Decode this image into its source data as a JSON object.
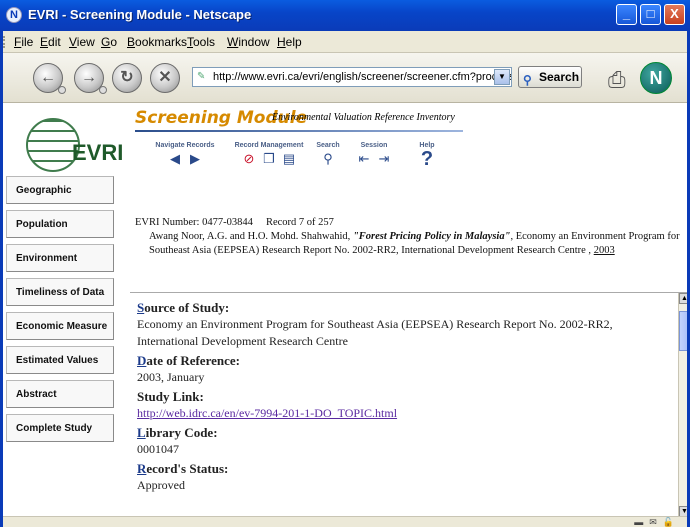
{
  "window": {
    "title": "EVRI - Screening Module - Netscape",
    "buttons": [
      "_",
      "□",
      "X"
    ]
  },
  "menu": [
    {
      "u": "F",
      "rest": "ile"
    },
    {
      "u": "E",
      "rest": "dit"
    },
    {
      "u": "V",
      "rest": "iew"
    },
    {
      "u": "G",
      "rest": "o"
    },
    {
      "u": "B",
      "rest": "ookmarks"
    },
    {
      "u": "T",
      "rest": "ools"
    },
    {
      "u": "W",
      "rest": "indow"
    },
    {
      "u": "H",
      "rest": "elp"
    }
  ],
  "toolbar": {
    "url": "http://www.evri.ca/evri/english/screener/screener.cfm?process=n",
    "search_label": "Search"
  },
  "header": {
    "logo_text": "EVRI",
    "module_title": "Screening Module",
    "module_subtitle": "Environmental Valuation Reference Inventory",
    "groups": {
      "navigate": "Navigate Records",
      "record_mgmt": "Record Management",
      "search": "Search",
      "session": "Session",
      "help": "Help"
    }
  },
  "sidebar": {
    "items": [
      "Geographic",
      "Population",
      "Environment",
      "Timeliness of Data",
      "Economic Measure",
      "Estimated Values",
      "Abstract",
      "Complete Study"
    ]
  },
  "record": {
    "evri_number_label": "EVRI Number: 0477-03844",
    "record_position": "Record 7 of 257",
    "citation_authors": "Awang Noor, A.G. and H.O. Mohd. Shahwahid, ",
    "citation_title": "\"Forest Pricing Policy in Malaysia\"",
    "citation_rest": ", Economy an Environment Program for Southeast Asia (EEPSEA) Research Report No. 2002-RR2, International Development Research Centre , ",
    "citation_year": "2003"
  },
  "details": {
    "source_cap": "S",
    "source_rest": "ource of Study:",
    "source_value": "Economy an Environment Program for Southeast Asia (EEPSEA) Research Report No. 2002-RR2, International Development Research Centre",
    "date_cap": "D",
    "date_rest": "ate of Reference:",
    "date_value": "2003, January",
    "link_label": "Study Link:",
    "link_value": "http://web.idrc.ca/en/ev-7994-201-1-DO_TOPIC.html",
    "library_cap": "L",
    "library_rest": "ibrary Code:",
    "library_value": "0001047",
    "status_cap": "R",
    "status_rest": "ecord's Status:",
    "status_value": "Approved"
  },
  "colors": {
    "titlebar": "#0a46cc",
    "module_title": "#d68a00",
    "heading_cap": "#1b3a8a",
    "link": "#5a2aa0"
  }
}
